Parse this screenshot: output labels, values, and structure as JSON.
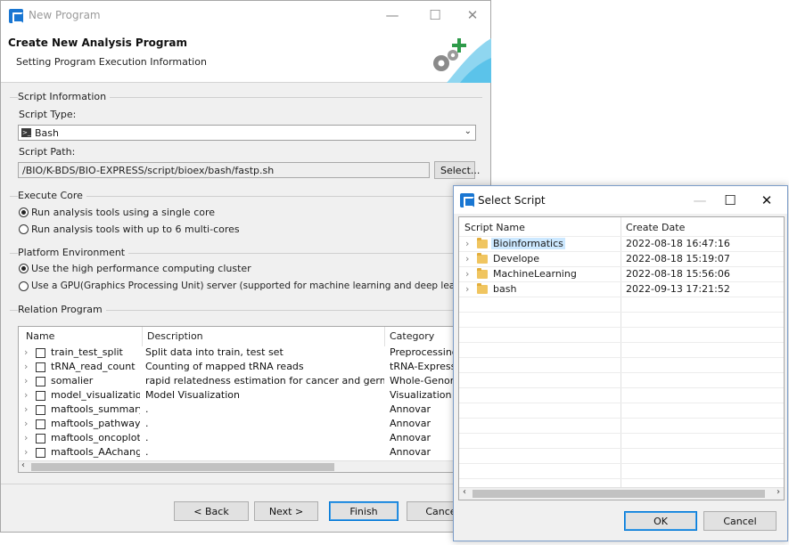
{
  "main": {
    "title": "New Program",
    "header_title": "Create New Analysis Program",
    "header_subtitle": "Setting Program Execution Information",
    "script_info": {
      "group_title": "Script Information",
      "type_label": "Script Type:",
      "type_value": "Bash",
      "path_label": "Script Path:",
      "path_value": "/BIO/K-BDS/BIO-EXPRESS/script/bioex/bash/fastp.sh",
      "select_label": "Select..."
    },
    "execute_core": {
      "group_title": "Execute Core",
      "single": "Run analysis tools using a single core",
      "multi": "Run analysis tools with up to 6 multi-cores"
    },
    "platform": {
      "group_title": "Platform Environment",
      "hpc": "Use the high performance computing cluster",
      "gpu": "Use a GPU(Graphics Processing Unit) server (supported for machine learning and deep learning)"
    },
    "relation": {
      "group_title": "Relation Program",
      "columns": [
        "Name",
        "Description",
        "Category"
      ],
      "rows": [
        {
          "name": "train_test_split",
          "desc": "Split data into train, test set",
          "cat": "Preprocessing"
        },
        {
          "name": "tRNA_read_count",
          "desc": "Counting of mapped tRNA reads",
          "cat": "tRNA-Expression"
        },
        {
          "name": "somalier",
          "desc": "rapid relatedness estimation for cancer and germline...",
          "cat": "Whole-Genome"
        },
        {
          "name": "model_visualization",
          "desc": "Model Visualization",
          "cat": "Visualization"
        },
        {
          "name": "maftools_summary",
          "desc": ".",
          "cat": "Annovar"
        },
        {
          "name": "maftools_pathway_di",
          "desc": ".",
          "cat": "Annovar"
        },
        {
          "name": "maftools_oncoplot",
          "desc": ".",
          "cat": "Annovar"
        },
        {
          "name": "maftools_AAchange",
          "desc": ".",
          "cat": "Annovar"
        }
      ]
    },
    "buttons": {
      "back": "< Back",
      "next": "Next >",
      "finish": "Finish",
      "cancel": "Cancel"
    }
  },
  "dialog": {
    "title": "Select Script",
    "columns": [
      "Script Name",
      "Create Date"
    ],
    "rows": [
      {
        "name": "Bioinformatics",
        "date": "2022-08-18 16:47:16"
      },
      {
        "name": "Develope",
        "date": "2022-08-18 15:19:07"
      },
      {
        "name": "MachineLearning",
        "date": "2022-08-18 15:56:06"
      },
      {
        "name": "bash",
        "date": "2022-09-13 17:21:52"
      }
    ],
    "ok": "OK",
    "cancel": "Cancel"
  },
  "colors": {
    "accent": "#0078d7",
    "selection": "#cce8ff",
    "folder": "#f0c560"
  }
}
